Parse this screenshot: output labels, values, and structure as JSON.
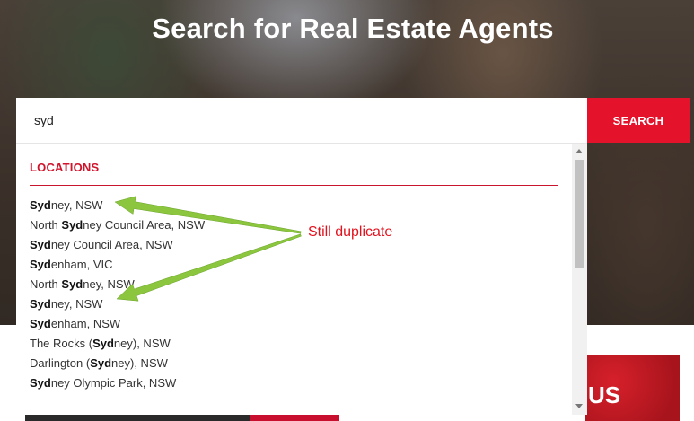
{
  "page": {
    "title": "Search for Real Estate Agents"
  },
  "search": {
    "value": "syd",
    "button_label": "SEARCH"
  },
  "dropdown": {
    "heading": "LOCATIONS",
    "items": [
      {
        "pre": "",
        "match": "Syd",
        "post": "ney, NSW"
      },
      {
        "pre": "North ",
        "match": "Syd",
        "post": "ney Council Area, NSW"
      },
      {
        "pre": "",
        "match": "Syd",
        "post": "ney Council Area, NSW"
      },
      {
        "pre": "",
        "match": "Syd",
        "post": "enham, VIC"
      },
      {
        "pre": "North ",
        "match": "Syd",
        "post": "ney, NSW"
      },
      {
        "pre": "",
        "match": "Syd",
        "post": "ney, NSW"
      },
      {
        "pre": "",
        "match": "Syd",
        "post": "enham, NSW"
      },
      {
        "pre": "The Rocks (",
        "match": "Syd",
        "post": "ney), NSW"
      },
      {
        "pre": "Darlington (",
        "match": "Syd",
        "post": "ney), NSW"
      },
      {
        "pre": "",
        "match": "Syd",
        "post": "ney Olympic Park, NSW"
      }
    ]
  },
  "annotation": {
    "text": "Still duplicate",
    "color": "#e3121e",
    "arrow_color": "#8cc63f"
  },
  "promo": {
    "text": "US"
  },
  "colors": {
    "accent": "#e4122b",
    "heading": "#d0142c"
  }
}
